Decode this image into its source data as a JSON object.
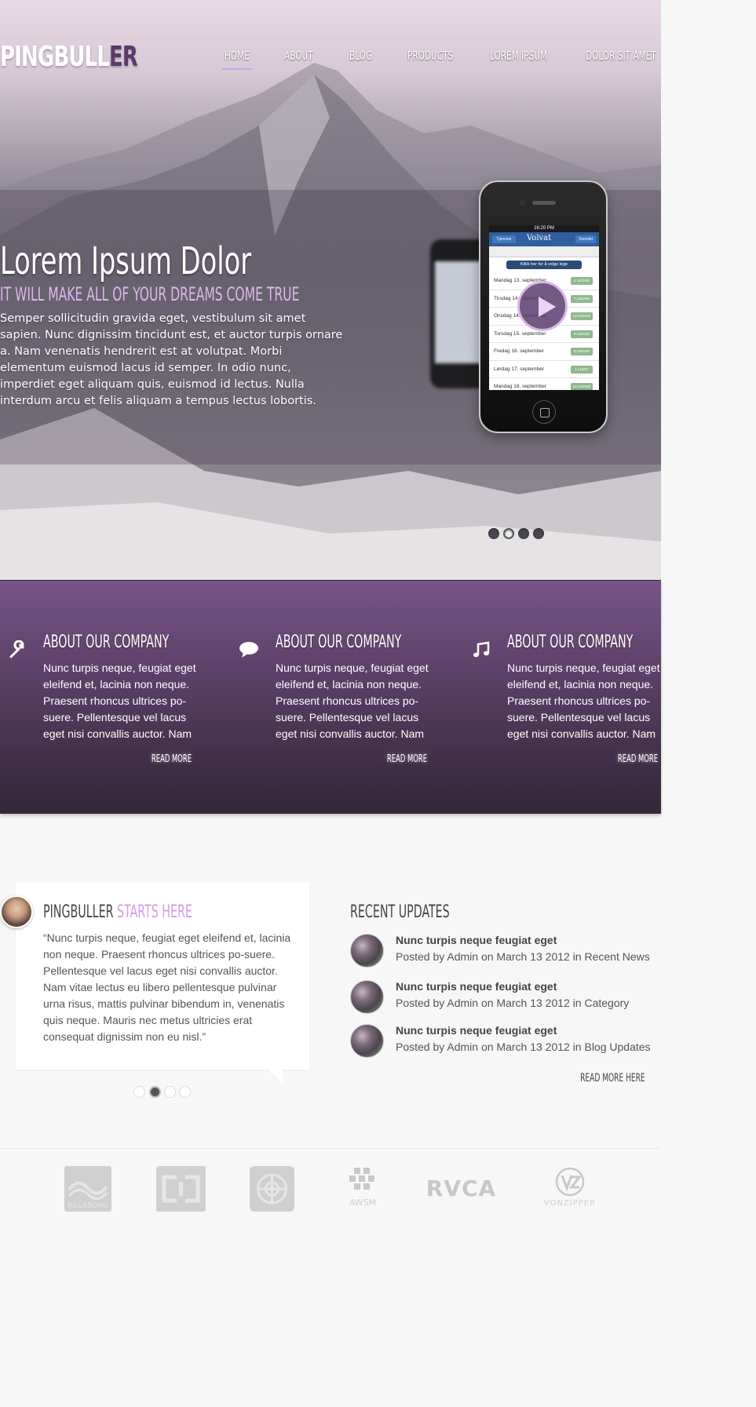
{
  "brand": {
    "name_main": "PINGBULL",
    "name_accent": "ER"
  },
  "nav": {
    "items": [
      {
        "label": "HOME",
        "active": true
      },
      {
        "label": "ABOUT",
        "active": false
      },
      {
        "label": "BLOG",
        "active": false
      },
      {
        "label": "PRODUCTS",
        "active": false
      },
      {
        "label": "LOREM IPSUM",
        "active": false
      },
      {
        "label": "DOLOR SIT AMET",
        "active": false
      }
    ]
  },
  "hero": {
    "title": "Lorem Ipsum Dolor",
    "subtitle": "IT WILL MAKE ALL OF YOUR DREAMS COME TRUE",
    "text": "Semper sollicitudin gravida eget, vestibulum sit amet sapien. Nunc dignissim tincidunt est, et auctor turpis ornare a. Nam venenatis hendrerit est at volutpat. Morbi elementum euismod lacus id semper. In odio nunc, imperdiet eget aliquam quis, euismod id lectus. Nulla interdum arcu et felis aliquam a tempus lectus lobortis.",
    "phone_screen": {
      "time": "16:20 PM",
      "back_label": "Tjeneste",
      "app_name": "Volvat",
      "right_label": "Svenskt",
      "cta": "Klikk her for å velge lege",
      "rows": [
        {
          "date": "Mandag 13. september",
          "tag": "4 LEDIGE"
        },
        {
          "date": "Tirsdag 14. september",
          "tag": "7 LEDIGE"
        },
        {
          "date": "Onsdag 14. september",
          "tag": "13 LEDIGE"
        },
        {
          "date": "Torsdag 15. september",
          "tag": "9 LEDIGE"
        },
        {
          "date": "Fredag 16. september",
          "tag": "8 LEDIGE"
        },
        {
          "date": "Lørdag 17. september",
          "tag": "1 LEDIG"
        },
        {
          "date": "Mandag 18. september",
          "tag": "13 LEDIGE"
        }
      ]
    },
    "slider": {
      "count": 4,
      "active_index": 1
    }
  },
  "features": [
    {
      "icon": "wrench-icon",
      "title": "ABOUT OUR COMPANY",
      "text": "Nunc turpis neque, feugiat eget eleifend et, lacinia non neque. Praesent rhoncus ultrices po-suere. Pellentesque vel lacus eget nisi convallis auctor. Nam",
      "more": "READ MORE"
    },
    {
      "icon": "speech-bubble-icon",
      "title": "ABOUT OUR COMPANY",
      "text": "Nunc turpis neque, feugiat eget eleifend et, lacinia non neque. Praesent rhoncus ultrices po-suere. Pellentesque vel lacus eget nisi convallis auctor. Nam",
      "more": "READ MORE"
    },
    {
      "icon": "music-note-icon",
      "title": "ABOUT OUR COMPANY",
      "text": "Nunc turpis neque, feugiat eget eleifend et, lacinia non neque. Praesent rhoncus ultrices po-suere. Pellentesque vel lacus eget nisi convallis auctor. Nam",
      "more": "READ MORE"
    }
  ],
  "testimonial": {
    "title_main": "PINGBULLER",
    "title_accent": "STARTS HERE",
    "quote": "“Nunc turpis neque, feugiat eget eleifend et, lacinia non neque. Praesent rhoncus ultrices po-suere. Pellentesque vel lacus eget nisi convallis auctor. Nam vitae lectus eu libero pellentesque pulvinar urna risus, mattis pulvinar bibendum in, venenatis quis neque. Mauris nec metus ultricies erat consequat dignissim non eu nisl.”",
    "slider": {
      "count": 4,
      "active_index": 1
    }
  },
  "recent_updates": {
    "title": "RECENT UPDATES",
    "items": [
      {
        "headline": "Nunc turpis neque feugiat eget",
        "meta": "Posted by Admin on March 13 2012 in Recent News"
      },
      {
        "headline": "Nunc turpis neque feugiat eget",
        "meta": "Posted by Admin on March 13 2012 in Category"
      },
      {
        "headline": "Nunc turpis neque feugiat eget",
        "meta": "Posted by Admin on March 13 2012 in Blog Updates"
      }
    ],
    "more": "READ MORE HERE"
  },
  "brands": [
    {
      "name": "BILLABONG",
      "icon": "billabong-logo"
    },
    {
      "name": "DC",
      "icon": "dc-logo"
    },
    {
      "name": "ELEMENT",
      "icon": "element-logo"
    },
    {
      "name": "AWSM",
      "icon": "awsm-logo"
    },
    {
      "name": "RVCA",
      "icon": "rvca-logo"
    },
    {
      "name": "VONZIPPER",
      "icon": "vonzipper-logo"
    }
  ],
  "colors": {
    "accent": "#d49ae8",
    "brand_dark": "#5b3a69",
    "features_top": "#775485",
    "features_bottom": "#33263a"
  }
}
